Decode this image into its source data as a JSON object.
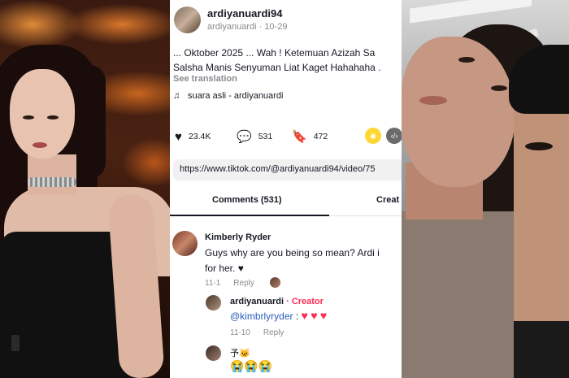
{
  "post": {
    "username": "ardiyanuardi94",
    "subline": "ardiyanuardi · 10-29",
    "caption_line1": "... Oktober 2025 ... Wah ! Ketemuan Azizah Sa",
    "caption_line2": "Salsha Manis Senyuman Liat Kaget Hahahaha .",
    "see_translation": "See translation",
    "sound": "suara asli - ardiyanuardi",
    "likes": "23.4K",
    "comments": "531",
    "saves": "472",
    "url": "https://www.tiktok.com/@ardiyanuardi94/video/75"
  },
  "tabs": {
    "comments": "Comments (531)",
    "creator": "Creat"
  },
  "comments": [
    {
      "name": "Kimberly Ryder",
      "line1": "Guys why are you being so mean? Ardi i",
      "line2": "for her. ♥",
      "date": "11-1",
      "reply": "Reply"
    },
    {
      "name": "ardiyanuardi",
      "badge": "· Creator",
      "mention": "@kimbrlyryder",
      "suffix": " : ",
      "date": "11-10",
      "reply": "Reply"
    },
    {
      "name": "予🐱",
      "emojis": "😭😭😭"
    }
  ],
  "icons": {
    "heart": "heart-icon",
    "comment": "comment-icon",
    "bookmark": "bookmark-icon",
    "share": "share-icon",
    "embed": "embed-icon",
    "music": "music-note-icon"
  },
  "colors": {
    "accent": "#fe2c55",
    "mention": "#2b5db9",
    "share_yellow": "#fdd835"
  }
}
